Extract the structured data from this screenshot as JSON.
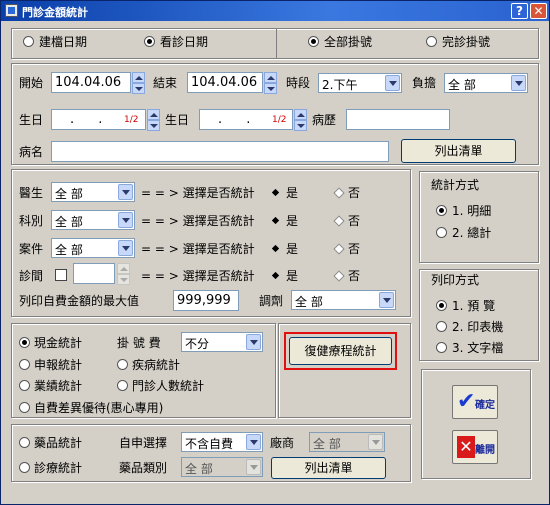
{
  "window": {
    "title": "門診金額統計"
  },
  "date_type": {
    "options": [
      "建檔日期",
      "看診日期"
    ],
    "selected": 1
  },
  "reg_type": {
    "options": [
      "全部掛號",
      "完診掛號"
    ],
    "selected": 0
  },
  "row2": {
    "start_label": "開始",
    "start_value": "104.04.06",
    "end_label": "結束",
    "end_value": "104.04.06",
    "period_label": "時段",
    "period_value": "2.下午",
    "burden_label": "負擔",
    "burden_value": "全 部"
  },
  "row3": {
    "birth1_label": "生日",
    "birth1_value": ". .",
    "birth1_marker": "1/2",
    "birth2_label": "生日",
    "birth2_value": ". .",
    "birth2_marker": "1/2",
    "history_label": "病歷",
    "history_value": ""
  },
  "row4": {
    "disease_label": "病名",
    "disease_value": "",
    "list_button": "列出清單"
  },
  "filters": {
    "arrow_text": "= = > 選擇是否統計",
    "yes": "是",
    "no": "否",
    "rows": [
      {
        "label": "醫生",
        "value": "全 部"
      },
      {
        "label": "科別",
        "value": "全 部"
      },
      {
        "label": "案件",
        "value": "全 部"
      },
      {
        "label": "診間",
        "value": ""
      }
    ]
  },
  "max_amount": {
    "label": "列印自費金額的最大值",
    "value": "999,999",
    "adjust_label": "調劑",
    "adjust_value": "全 部"
  },
  "stat_method": {
    "title": "統計方式",
    "options": [
      "1. 明細",
      "2. 總計"
    ],
    "selected": 0
  },
  "print_method": {
    "title": "列印方式",
    "options": [
      "1. 預 覽",
      "2. 印表機",
      "3. 文字檔"
    ],
    "selected": 0
  },
  "stats": {
    "cash": "現金統計",
    "reg_fee_label": "掛 號 費",
    "reg_fee_value": "不分",
    "report": "申報統計",
    "disease": "疾病統計",
    "performance": "業績統計",
    "visitors": "門診人數統計",
    "self_pay": "自費差異優待(惠心專用)",
    "rehab_button": "復健療程統計"
  },
  "drugs": {
    "drug_stat": "藥品統計",
    "self_select_label": "自申選擇",
    "self_select_value": "不含自費",
    "vendor_label": "廠商",
    "vendor_value": "全 部",
    "treat_stat": "診療統計",
    "category_label": "藥品類別",
    "category_value": "全 部",
    "list_button": "列出清單"
  },
  "actions": {
    "confirm": "確定",
    "leave": "離開"
  }
}
